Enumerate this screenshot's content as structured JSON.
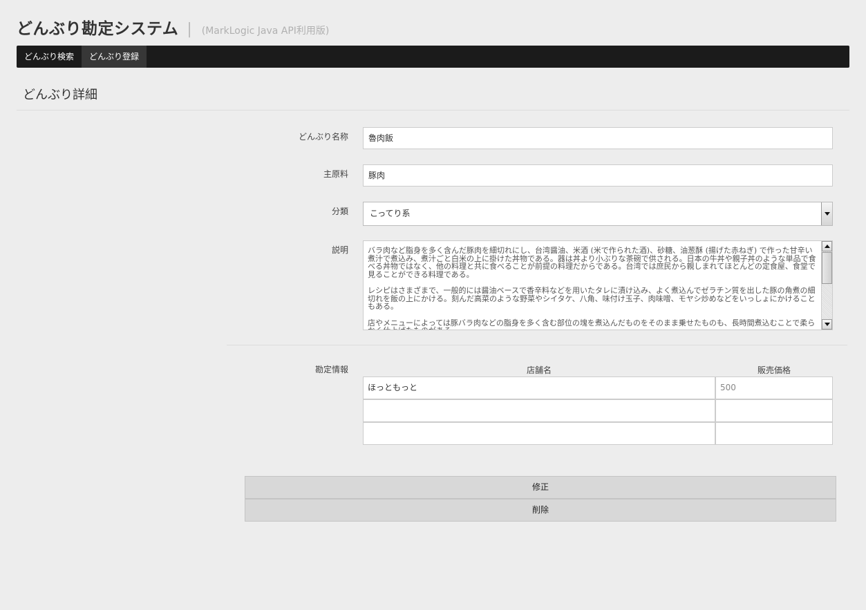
{
  "header": {
    "title": "どんぶり勘定システム",
    "separator": "|",
    "subtitle": "(MarkLogic Java API利用版)"
  },
  "nav": {
    "items": [
      {
        "label": "どんぶり検索"
      },
      {
        "label": "どんぶり登録"
      }
    ]
  },
  "section": {
    "title": "どんぶり詳細"
  },
  "form": {
    "name_label": "どんぶり名称",
    "name_value": "魯肉飯",
    "ingredient_label": "主原料",
    "ingredient_value": "豚肉",
    "category_label": "分類",
    "category_value": "こってり系",
    "description_label": "説明",
    "description_paragraphs": [
      "バラ肉など脂身を多く含んだ豚肉を細切れにし、台湾醤油、米酒 (米で作られた酒)、砂糖、油葱酥 (揚げた赤ねぎ) で作った甘辛い煮汁で煮込み、煮汁ごと白米の上に掛けた丼物である。器は丼より小ぶりな茶碗で供される。日本の牛丼や親子丼のような単品で食べる丼物ではなく、他の料理と共に食べることが前提の料理だからである。台湾では庶民から親しまれてほとんどの定食屋、食堂で見ることができる料理である。",
      "レシピはさまざまで、一般的には醤油ベースで香辛料などを用いたタレに漬け込み、よく煮込んでゼラチン質を出した豚の角煮の細切れを飯の上にかける。刻んだ高菜のような野菜やシイタケ、八角、味付け玉子、肉味噌、モヤシ炒めなどをいっしょにかけることもある。",
      "店やメニューによっては豚バラ肉などの脂身を多く含む部位の塊を煮込んだものをそのまま乗せたものも、長時間煮込むことで柔らかく仕上げたものがある。"
    ]
  },
  "kanjo": {
    "label": "勘定情報",
    "col_store": "店舗名",
    "col_price": "販売価格",
    "rows": [
      {
        "store": "ほっともっと",
        "price": "500"
      },
      {
        "store": "",
        "price": ""
      },
      {
        "store": "",
        "price": ""
      }
    ]
  },
  "buttons": {
    "update": "修正",
    "delete": "削除"
  }
}
